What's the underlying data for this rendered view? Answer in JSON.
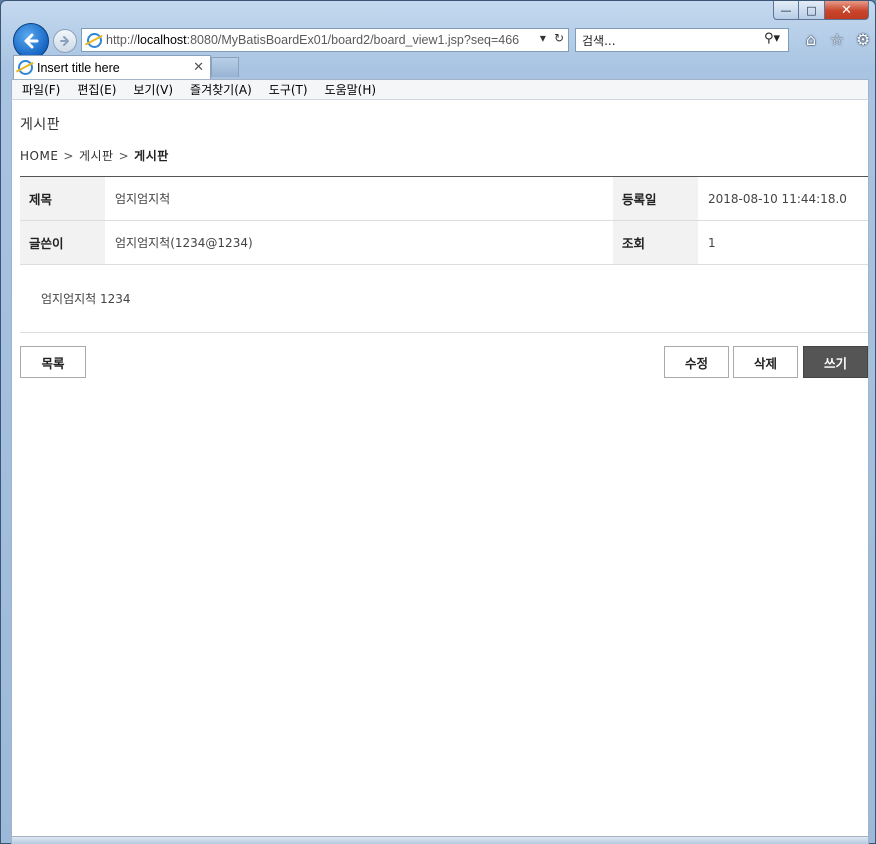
{
  "browser": {
    "address": {
      "prefix": "http://",
      "host": "localhost",
      "suffix": ":8080/MyBatisBoardEx01/board2/board_view1.jsp?seq=466"
    },
    "search_placeholder": "검색...",
    "tab_title": "Insert title here",
    "window_controls": {
      "minimize": "—",
      "maximize": "□",
      "close": "✕"
    },
    "icons": {
      "back": "back-arrow-icon",
      "forward": "forward-arrow-icon",
      "refresh": "refresh-icon",
      "dropdown": "chevron-down-icon",
      "search": "search-icon",
      "home": "home-icon",
      "favorites": "star-icon",
      "settings": "gear-icon"
    },
    "menu": [
      "파일(F)",
      "편집(E)",
      "보기(V)",
      "즐겨찾기(A)",
      "도구(T)",
      "도움말(H)"
    ]
  },
  "page": {
    "title": "게시판",
    "breadcrumb": [
      "HOME",
      "게시판",
      "게시판"
    ],
    "post": {
      "subject_label": "제목",
      "subject": "엄지엄지척",
      "date_label": "등록일",
      "date": "2018-08-10 11:44:18.0",
      "writer_label": "글쓴이",
      "writer": "엄지엄지척(1234@1234)",
      "hit_label": "조회",
      "hit": "1",
      "content": "엄지엄지척 1234"
    },
    "buttons": {
      "list": "목록",
      "edit": "수정",
      "delete": "삭제",
      "write": "쓰기"
    }
  }
}
